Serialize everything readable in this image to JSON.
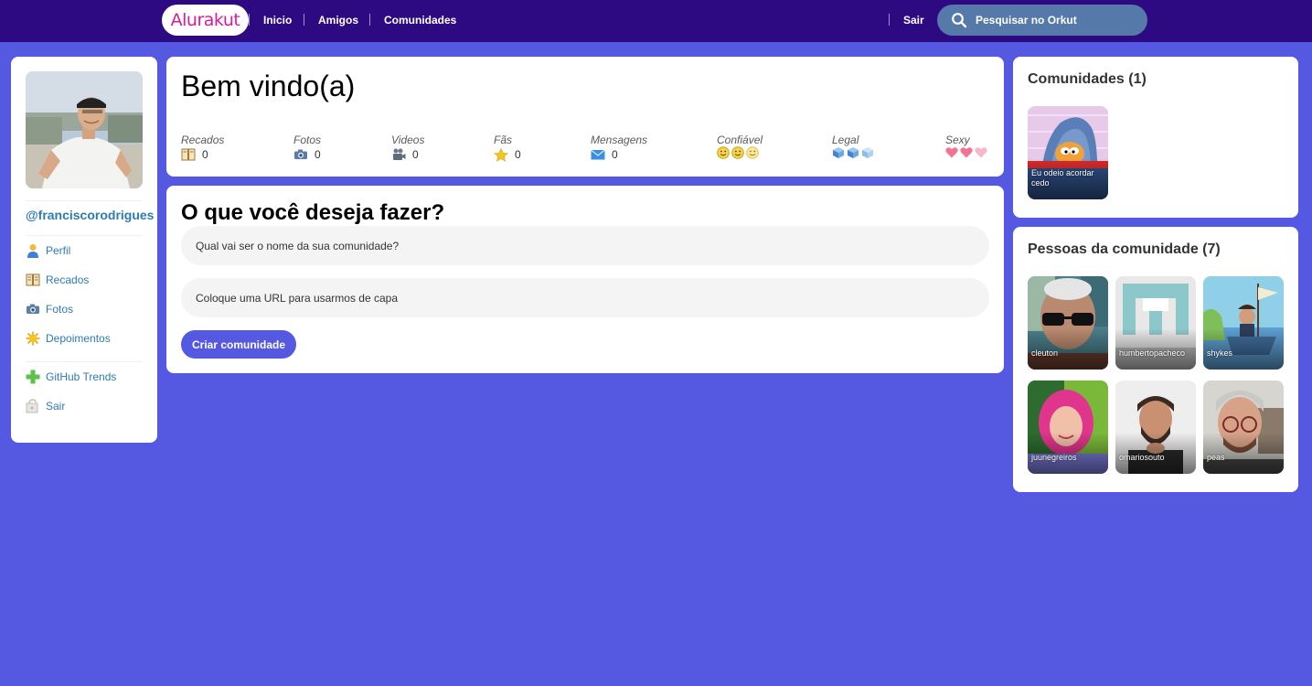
{
  "header": {
    "logo": "Alurakut",
    "nav": [
      "Inicio",
      "Amigos",
      "Comunidades"
    ],
    "logout": "Sair",
    "search_placeholder": "Pesquisar no Orkut"
  },
  "sidebar": {
    "username": "@franciscorodrigues",
    "items": [
      {
        "label": "Perfil",
        "icon": "user-icon"
      },
      {
        "label": "Recados",
        "icon": "book-icon"
      },
      {
        "label": "Fotos",
        "icon": "camera-icon"
      },
      {
        "label": "Depoimentos",
        "icon": "sun-icon"
      }
    ],
    "items2": [
      {
        "label": "GitHub Trends",
        "icon": "plus-icon"
      },
      {
        "label": "Sair",
        "icon": "logout-icon"
      }
    ]
  },
  "welcome": {
    "title": "Bem vindo(a)",
    "stats": [
      {
        "name": "Recados",
        "value": "0",
        "icon": "book-icon"
      },
      {
        "name": "Fotos",
        "value": "0",
        "icon": "camera-icon"
      },
      {
        "name": "Videos",
        "value": "0",
        "icon": "video-camera-icon"
      },
      {
        "name": "Fãs",
        "value": "0",
        "icon": "star-icon"
      },
      {
        "name": "Mensagens",
        "value": "0",
        "icon": "envelope-icon"
      },
      {
        "name": "Confiável",
        "icon": "smile-icon",
        "level": 3
      },
      {
        "name": "Legal",
        "icon": "cube-icon",
        "level": 3
      },
      {
        "name": "Sexy",
        "icon": "heart-icon",
        "level": 3
      }
    ]
  },
  "form": {
    "title": "O que você deseja fazer?",
    "name_placeholder": "Qual vai ser o nome da sua comunidade?",
    "url_placeholder": "Coloque uma URL para usarmos de capa",
    "submit": "Criar comunidade"
  },
  "communities": {
    "title": "Comunidades (1)",
    "items": [
      {
        "name": "Eu odeio acordar cedo"
      }
    ]
  },
  "people": {
    "title": "Pessoas da comunidade (7)",
    "items": [
      {
        "name": "cleuton"
      },
      {
        "name": "humbertopacheco"
      },
      {
        "name": "shykes"
      },
      {
        "name": "juunegreiros"
      },
      {
        "name": "omariosouto"
      },
      {
        "name": "peas"
      }
    ]
  },
  "colors": {
    "background": "#5558e0",
    "topbar": "#2e0a82",
    "logo_text": "#d81d99",
    "search": "#5579a9",
    "link": "#2e7bb4",
    "button": "#5558e0"
  }
}
